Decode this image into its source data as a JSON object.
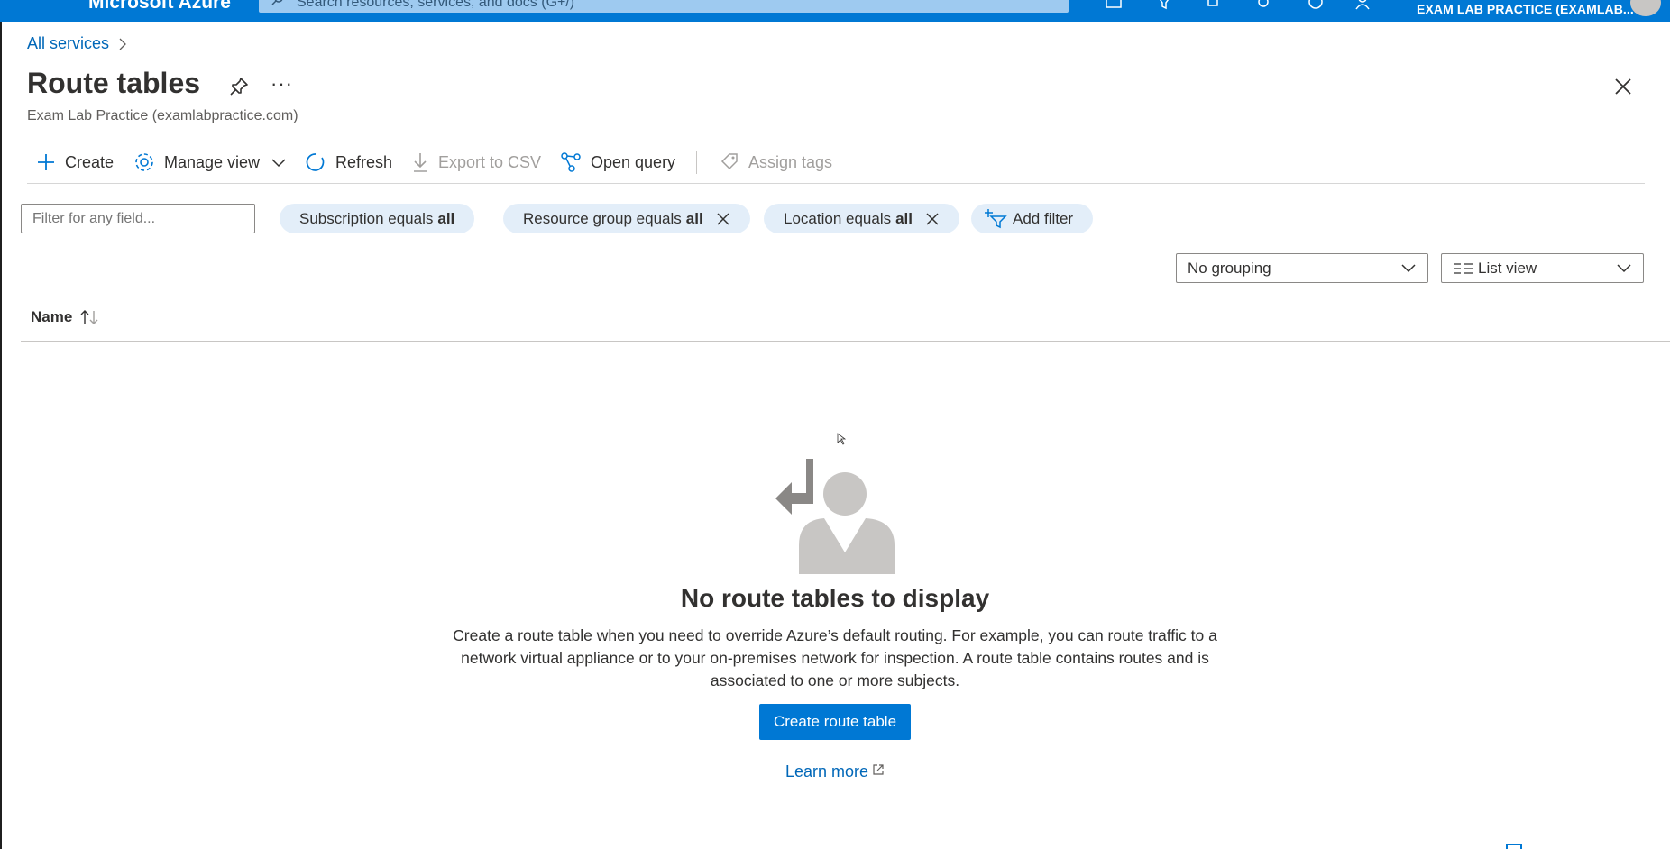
{
  "topbar": {
    "brand": "Microsoft Azure",
    "search_placeholder": "Search resources, services, and docs (G+/)",
    "account": "EXAM LAB PRACTICE (EXAMLAB..."
  },
  "breadcrumb": {
    "item": "All services"
  },
  "header": {
    "title": "Route tables",
    "more": "···",
    "subtitle": "Exam Lab Practice (examlabpractice.com)"
  },
  "commands": {
    "create": "Create",
    "manage_view": "Manage view",
    "refresh": "Refresh",
    "export_csv": "Export to CSV",
    "open_query": "Open query",
    "assign_tags": "Assign tags"
  },
  "filters": {
    "input_placeholder": "Filter for any field...",
    "subscription_label": "Subscription equals",
    "subscription_value": "all",
    "resource_group_label": "Resource group equals",
    "resource_group_value": "all",
    "location_label": "Location equals",
    "location_value": "all",
    "add_filter": "Add filter"
  },
  "view": {
    "grouping": "No grouping",
    "view_mode": "List view"
  },
  "table": {
    "columns": [
      "Name"
    ]
  },
  "empty_state": {
    "title": "No route tables to display",
    "description": "Create a route table when you need to override Azure’s default routing. For example, you can route traffic to a network virtual appliance or to your on-premises network for inspection. A route table contains routes and is associated to one or more subjects.",
    "primary_button": "Create route table",
    "learn_more": "Learn more"
  },
  "colors": {
    "accent": "#0078d4",
    "link": "#0067b8",
    "pill_bg": "#e3eef9"
  }
}
